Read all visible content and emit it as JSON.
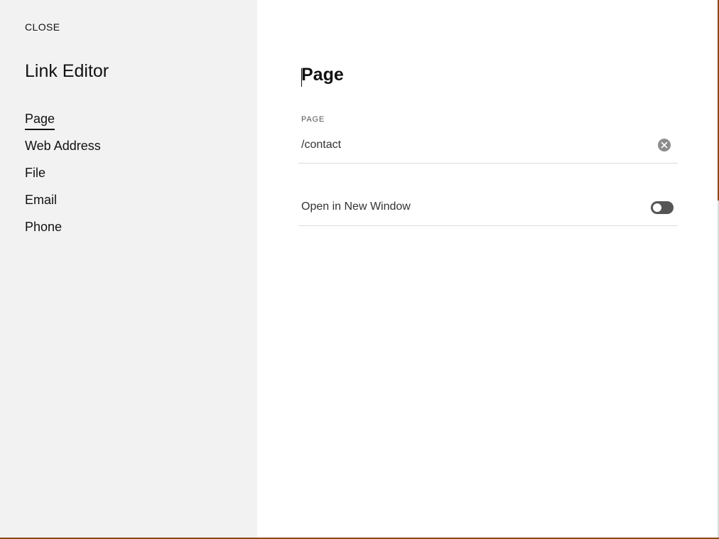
{
  "sidebar": {
    "close_label": "CLOSE",
    "title": "Link Editor",
    "items": [
      {
        "label": "Page",
        "active": true
      },
      {
        "label": "Web Address",
        "active": false
      },
      {
        "label": "File",
        "active": false
      },
      {
        "label": "Email",
        "active": false
      },
      {
        "label": "Phone",
        "active": false
      }
    ]
  },
  "main": {
    "title": "Page",
    "page_field": {
      "label": "PAGE",
      "value": "/contact"
    },
    "new_window_toggle": {
      "label": "Open in New Window",
      "enabled": false
    }
  },
  "colors": {
    "sidebar_background": "#f2f2f2",
    "content_background": "#ffffff",
    "toggle_off": "#555555",
    "window_edge": "#8a4b14"
  },
  "icons": {
    "clear": "clear-icon"
  }
}
